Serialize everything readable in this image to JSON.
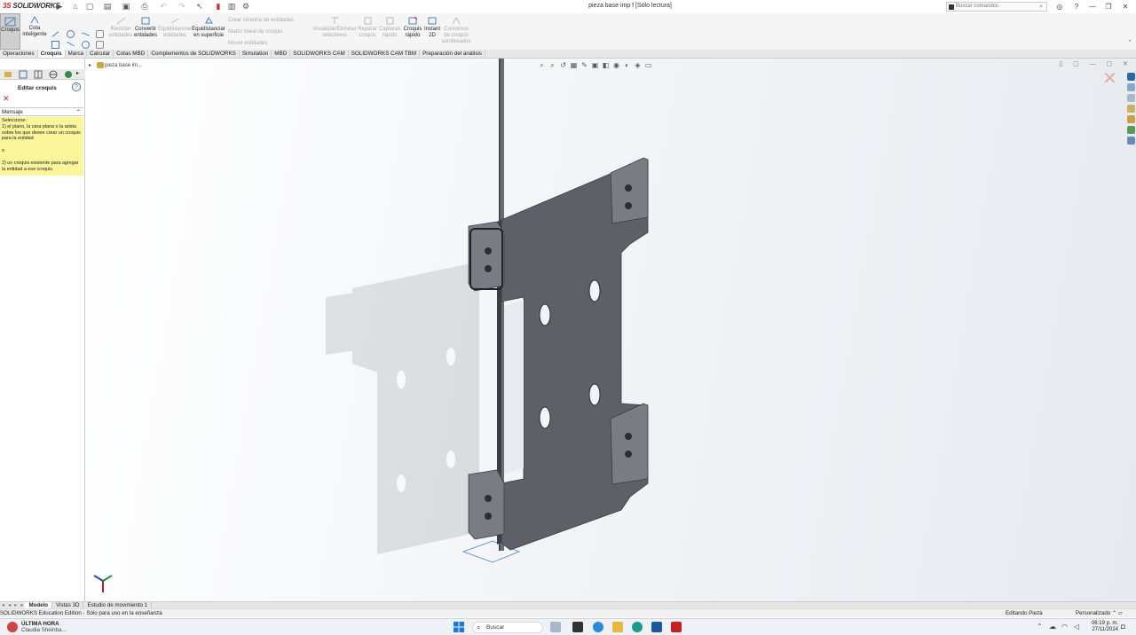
{
  "app": {
    "logo": "SOLIDWORKS",
    "document_title": "pieza base imp f [Sólo lectura]",
    "search_placeholder": "Buscar comandos"
  },
  "ribbon": {
    "croquis": "Croquis",
    "cota_inteligente": [
      "Cota",
      "inteligente"
    ],
    "recortar": [
      "Recortar",
      "entidades"
    ],
    "convertir": [
      "Convertir",
      "entidades"
    ],
    "equidistanciar": [
      "Equidistanciar",
      "entidades"
    ],
    "equidistanciar_sup": [
      "Equidistanciar",
      "en superficie"
    ],
    "crear_simetria": "Crear simetría de entidades",
    "matriz_lineal": "Matriz lineal de croquis",
    "mover_entidades": "Mover entidades",
    "visualizar": [
      "Visualizar/Eliminar",
      "relaciones"
    ],
    "reparar": [
      "Reparar",
      "croquis"
    ],
    "capturas": [
      "Capturas",
      "rápido"
    ],
    "croquis_rapido": [
      "Croquis",
      "rápido"
    ],
    "instant2d": [
      "Instant",
      "2D"
    ],
    "contornos": [
      "Contornos",
      "de croquis",
      "sombreados"
    ]
  },
  "tabs": [
    {
      "label": "Operaciones",
      "active": false
    },
    {
      "label": "Croquis",
      "active": true
    },
    {
      "label": "Marca",
      "active": false
    },
    {
      "label": "Calcular",
      "active": false
    },
    {
      "label": "Cotas MBD",
      "active": false
    },
    {
      "label": "Complementos de SOLIDWORKS",
      "active": false
    },
    {
      "label": "Simulation",
      "active": false
    },
    {
      "label": "MBD",
      "active": false
    },
    {
      "label": "SOLIDWORKS CAM",
      "active": false
    },
    {
      "label": "SOLIDWORKS CAM TBM",
      "active": false
    },
    {
      "label": "Preparación del análisis",
      "active": false
    }
  ],
  "panel": {
    "title": "Editar croquis",
    "message_header": "Mensaje",
    "message": {
      "line1": "Seleccione:",
      "line2": "1) el plano, la cara plana o la arista sobre los que desee crear un croquis para la entidad",
      "line3": "o",
      "line4": "2) un croquis existente para agregar la entidad a ese croquis."
    }
  },
  "tree": {
    "item": "pieza base im..."
  },
  "bottom_tabs": [
    {
      "label": "Modelo",
      "active": true
    },
    {
      "label": "Vistas 3D",
      "active": false
    },
    {
      "label": "Estudio de movimiento 1",
      "active": false
    }
  ],
  "status": {
    "left": "SOLIDWORKS Education Edition - Sólo para uso en la enseñanza",
    "mode": "Editando Pieza",
    "units": "Personalizado"
  },
  "taskbar": {
    "news_title": "ÚLTIMA HORA",
    "news_sub": "Claudia Sheinba...",
    "search": "Buscar",
    "time": "06:19 p. m.",
    "date": "27/11/2024"
  },
  "colors": {
    "accent_red": "#d02020",
    "message_bg": "#fbf59b",
    "part_face": "#5e6068",
    "part_edge": "#3c3e44"
  }
}
